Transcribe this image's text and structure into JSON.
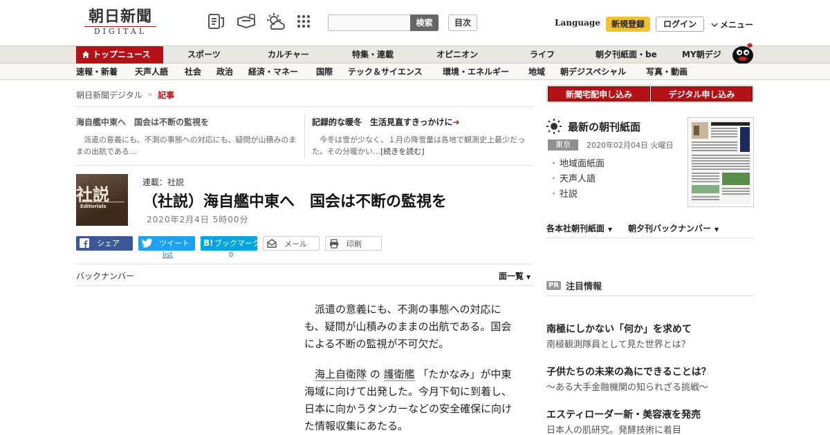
{
  "header": {
    "logo_main": "朝日新聞",
    "logo_sub": "DIGITAL",
    "icons": [
      "news-icon",
      "handshake-icon",
      "weather-icon",
      "grid-icon"
    ],
    "search": {
      "placeholder": "",
      "button": "検索"
    },
    "toc": "目次",
    "language": "Language",
    "signup": "新規登録",
    "login": "ログイン",
    "menu": "メニュー"
  },
  "nav_primary": [
    "トップニュース",
    "スポーツ",
    "カルチャー",
    "特集・連載",
    "オピニオン",
    "ライフ",
    "朝夕刊紙面・be",
    "MY朝デジ"
  ],
  "nav_secondary": [
    "速報・新着",
    "天声人語",
    "社会",
    "政治",
    "経済・マネー",
    "国際",
    "テック＆サイエンス",
    "環境・エネルギー",
    "地域",
    "朝デジスペシャル",
    "写真・動画"
  ],
  "breadcrumb": {
    "home": "朝日新聞デジタル",
    "sep": ">",
    "current": "記事"
  },
  "related": [
    {
      "title": "海自艦中東へ　国会は不断の監視を",
      "text": "派遣の意義にも、不測の事態への対応にも、疑問が山積みのままの出航である…"
    },
    {
      "title": "記録的な暖冬　生活見直すきっかけに",
      "text": "今冬は雪が少なく、１月の降雪量は各地で観測史上最少だった。その分暖かい…",
      "more": "[続きを読む]"
    }
  ],
  "article": {
    "thumb_kanji": "社説",
    "thumb_en": "Editorials",
    "series": "連載：社説",
    "title": "（社説）海自艦中東へ　国会は不断の監視を",
    "date": "2020年2月4日 5時00分",
    "share": {
      "facebook": "シェア",
      "twitter": "ツイート",
      "twitter_count": "list",
      "hatena": "ブックマーク",
      "hatena_count": "0",
      "mail": "メール",
      "print": "印刷"
    },
    "backnumber": "バックナンバー",
    "ichiran": "面一覧",
    "p1": "派遣の意義にも、不測の事態への対応にも、疑問が山積みのままの出航である。国会による不断の監視が不可欠だ。",
    "p2_link1": "海上自衛隊",
    "p2_sep": " の ",
    "p2_link2": "護衛艦",
    "p2_rest": " 「たかなみ」が中東海域に向けて出発した。今月下旬に到着し、日本に向かうタンカーなどの安全確保に向けた情報収集にあたる。"
  },
  "sidebar": {
    "btn_home_delivery": "新聞宅配申し込み",
    "btn_digital": "デジタル申し込み",
    "morning_title": "最新の朝刊紙面",
    "region": "東京",
    "paper_date": "2020年02月04日 火曜日",
    "links": [
      "地域面紙面",
      "天声人語",
      "社説"
    ],
    "dropdown1": "各本社朝刊紙面",
    "dropdown2": "朝夕刊バックナンバー",
    "pr_badge": "PR",
    "pr_title": "注目情報",
    "ads": [
      {
        "title": "南極にしかない「何か」を求めて",
        "sub": "南極観測隊員として見た世界とは？"
      },
      {
        "title": "子供たちの未来の為にできることは？",
        "sub": "～ある大手金融機関の知られざる挑戦～"
      },
      {
        "title": "エスティローダー新・美容液を発売",
        "sub": "日本人の肌研究。発酵技術に着目"
      }
    ]
  },
  "colors": {
    "brand_red": "#b31217",
    "signup_yellow": "#f3c233",
    "facebook": "#3b5998",
    "twitter": "#1da1f2",
    "hatena": "#00a4de"
  }
}
